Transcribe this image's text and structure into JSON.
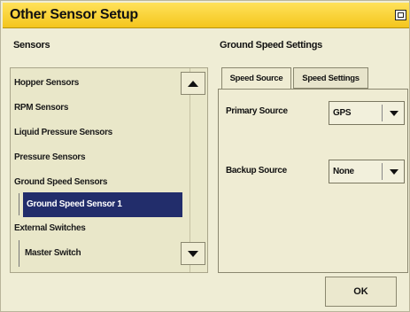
{
  "window": {
    "title": "Other Sensor Setup"
  },
  "sensors": {
    "label": "Sensors",
    "items": [
      {
        "label": "Hopper Sensors",
        "child": false,
        "selected": false
      },
      {
        "label": "RPM Sensors",
        "child": false,
        "selected": false
      },
      {
        "label": "Liquid Pressure Sensors",
        "child": false,
        "selected": false
      },
      {
        "label": "Pressure Sensors",
        "child": false,
        "selected": false
      },
      {
        "label": "Ground Speed Sensors",
        "child": false,
        "selected": false
      },
      {
        "label": "Ground Speed Sensor 1",
        "child": true,
        "selected": true
      },
      {
        "label": "External Switches",
        "child": false,
        "selected": false
      },
      {
        "label": "Master Switch",
        "child": true,
        "selected": false
      }
    ]
  },
  "ground_speed": {
    "label": "Ground Speed Settings",
    "tabs": [
      {
        "label": "Speed Source",
        "active": true
      },
      {
        "label": "Speed Settings",
        "active": false
      }
    ],
    "primary": {
      "label": "Primary Source",
      "value": "GPS"
    },
    "backup": {
      "label": "Backup Source",
      "value": "None"
    }
  },
  "buttons": {
    "ok": "OK"
  },
  "colors": {
    "title_bar": "#f4c51d",
    "selection": "#222d6b",
    "panel": "#efecd3"
  }
}
